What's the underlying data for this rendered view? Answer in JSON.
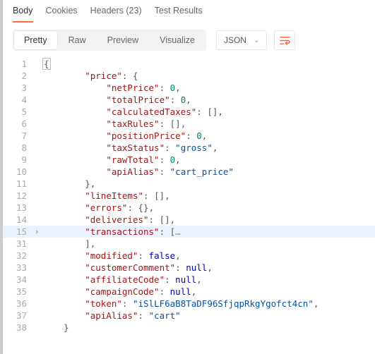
{
  "tabs": {
    "body": "Body",
    "cookies": "Cookies",
    "headers": "Headers (23)",
    "tests": "Test Results"
  },
  "viewModes": {
    "pretty": "Pretty",
    "raw": "Raw",
    "preview": "Preview",
    "visualize": "Visualize"
  },
  "format": {
    "selected": "JSON"
  },
  "lines": [
    {
      "num": "1"
    },
    {
      "num": "2"
    },
    {
      "num": "3"
    },
    {
      "num": "4"
    },
    {
      "num": "5"
    },
    {
      "num": "6"
    },
    {
      "num": "7"
    },
    {
      "num": "8"
    },
    {
      "num": "9"
    },
    {
      "num": "10"
    },
    {
      "num": "11"
    },
    {
      "num": "12"
    },
    {
      "num": "13"
    },
    {
      "num": "14"
    },
    {
      "num": "15"
    },
    {
      "num": "31"
    },
    {
      "num": "32"
    },
    {
      "num": "33"
    },
    {
      "num": "34"
    },
    {
      "num": "35"
    },
    {
      "num": "36"
    },
    {
      "num": "37"
    },
    {
      "num": "38"
    }
  ],
  "json": {
    "price_key": "\"price\"",
    "netPrice_key": "\"netPrice\"",
    "totalPrice_key": "\"totalPrice\"",
    "calculatedTaxes_key": "\"calculatedTaxes\"",
    "taxRules_key": "\"taxRules\"",
    "positionPrice_key": "\"positionPrice\"",
    "taxStatus_key": "\"taxStatus\"",
    "taxStatus_val": "\"gross\"",
    "rawTotal_key": "\"rawTotal\"",
    "apiAlias_key": "\"apiAlias\"",
    "apiAlias_price_val": "\"cart_price\"",
    "lineItems_key": "\"lineItems\"",
    "errors_key": "\"errors\"",
    "deliveries_key": "\"deliveries\"",
    "transactions_key": "\"transactions\"",
    "modified_key": "\"modified\"",
    "modified_val": "false",
    "customerComment_key": "\"customerComment\"",
    "affiliateCode_key": "\"affiliateCode\"",
    "campaignCode_key": "\"campaignCode\"",
    "null_val": "null",
    "token_key": "\"token\"",
    "token_val": "\"iSlLF6aB8TaDF96SfjqpRkgYgofct4cn\"",
    "apiAlias_cart_val": "\"cart\"",
    "zero": "0",
    "empty_arr": "[]",
    "empty_obj": "{}",
    "ellipsis": "…",
    "open_brace": "{",
    "close_brace": "}",
    "open_brk": "[",
    "close_brk": "]",
    "colon": ": ",
    "comma": ","
  }
}
